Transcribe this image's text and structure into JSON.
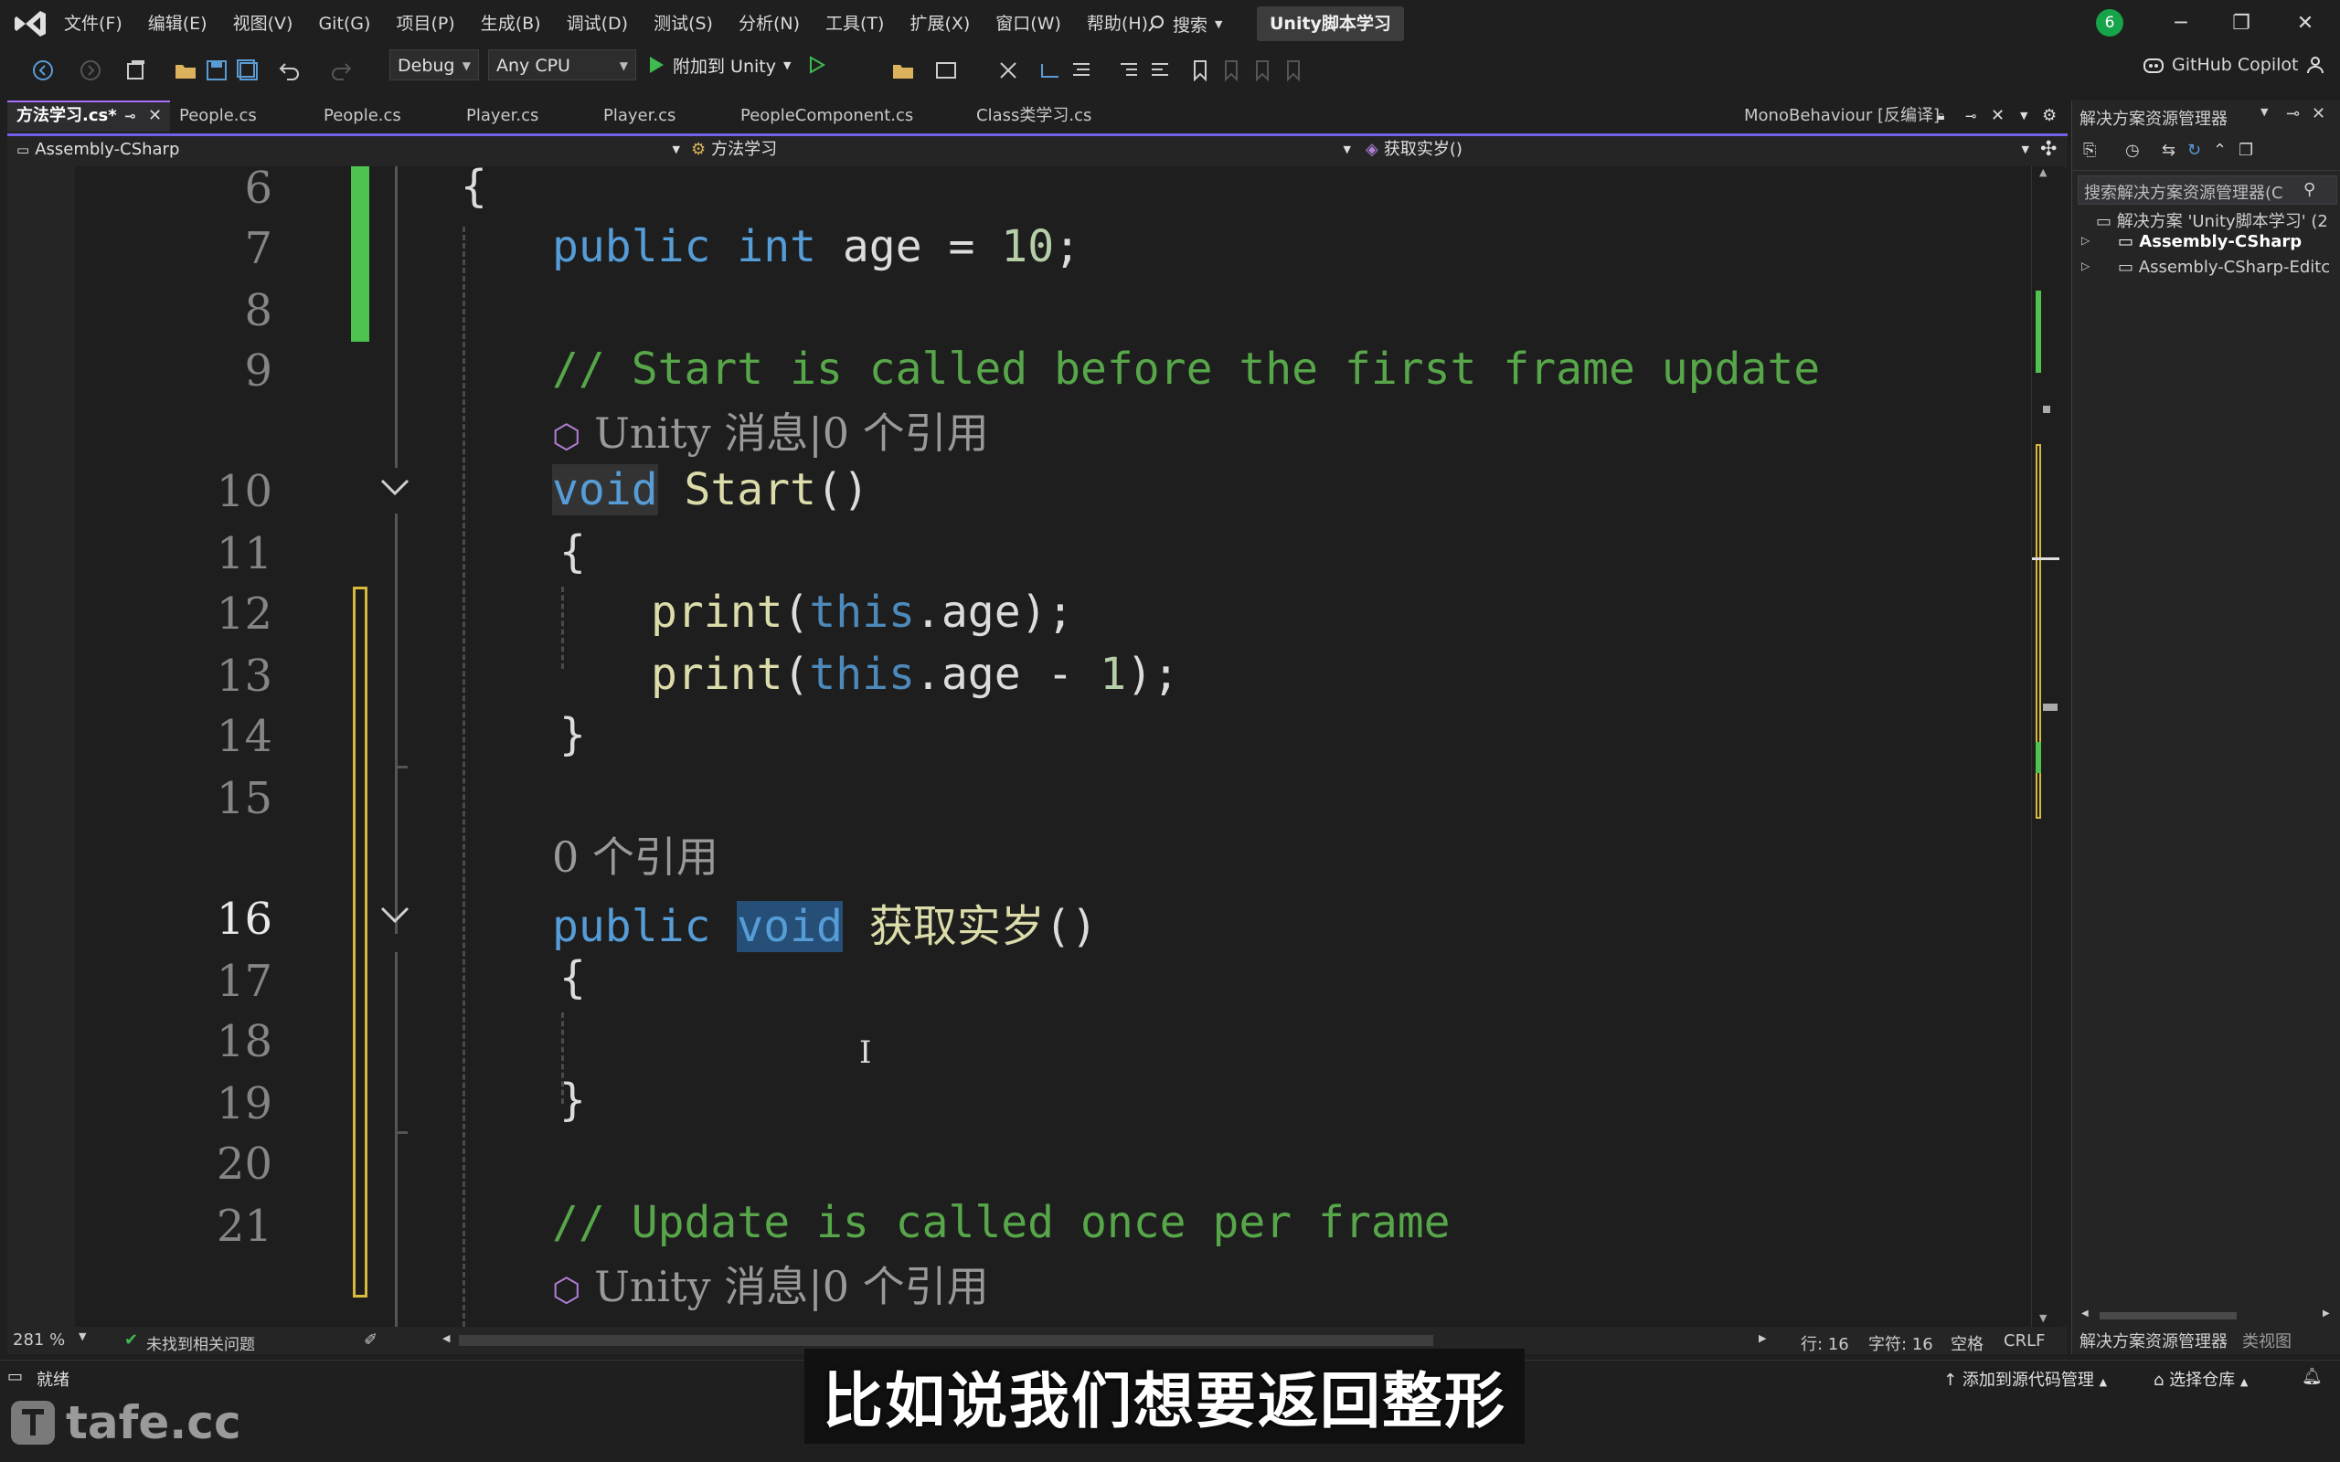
{
  "title_bar": {
    "menu": [
      "文件(F)",
      "编辑(E)",
      "视图(V)",
      "Git(G)",
      "项目(P)",
      "生成(B)",
      "调试(D)",
      "测试(S)",
      "分析(N)",
      "工具(T)",
      "扩展(X)",
      "窗口(W)",
      "帮助(H)"
    ],
    "search_label": "搜索",
    "project_name": "Unity脚本学习",
    "notification_count": "6"
  },
  "toolbar": {
    "config": "Debug",
    "platform": "Any CPU",
    "attach_label": "附加到 Unity",
    "copilot_label": "GitHub Copilot"
  },
  "tabs": [
    {
      "label": "方法学习.cs*",
      "active": true
    },
    {
      "label": "People.cs"
    },
    {
      "label": "People.cs"
    },
    {
      "label": "Player.cs"
    },
    {
      "label": "Player.cs"
    },
    {
      "label": "PeopleComponent.cs"
    },
    {
      "label": "Class类学习.cs"
    }
  ],
  "right_tab": "MonoBehaviour [反编译]",
  "navbar": {
    "project": "Assembly-CSharp",
    "class": "方法学习",
    "member": "获取实岁()"
  },
  "editor": {
    "line_numbers": [
      "6",
      "7",
      "8",
      "9",
      "10",
      "11",
      "12",
      "13",
      "14",
      "15",
      "16",
      "17",
      "18",
      "19",
      "20",
      "21"
    ],
    "current_line": "16",
    "code": {
      "brace_open": "{",
      "l7_kw1": "public",
      "l7_kw2": "int",
      "l7_rest": "age = ",
      "l7_num": "10",
      "l7_end": ";",
      "l9_comment": "// Start is called before the first frame update",
      "lens_start": "Unity 消息|0 个引用",
      "l10_void": "void",
      "l10_name": "Start",
      "l10_paren": "()",
      "l12_print": "print",
      "l12_open": "(",
      "l12_this": "this",
      "l12_rest": ".age);",
      "l13_print": "print",
      "l13_open": "(",
      "l13_this": "this",
      "l13_mid": ".age - ",
      "l13_num": "1",
      "l13_end": ");",
      "brace_close": "}",
      "lens_refs": "0 个引用",
      "l16_public": "public",
      "l16_void": "void",
      "l16_name": "获取实岁",
      "l16_paren": "()",
      "l21_comment": "// Update is called once per frame",
      "lens_update": "Unity 消息|0 个引用"
    }
  },
  "editor_status": {
    "zoom": "281 %",
    "issues": "未找到相关问题",
    "line": "行: 16",
    "col": "字符: 16",
    "whitespace": "空格",
    "eol": "CRLF"
  },
  "solution_explorer": {
    "title": "解决方案资源管理器",
    "search_placeholder": "搜索解决方案资源管理器(C",
    "solution": "解决方案 'Unity脚本学习' (2",
    "projects": [
      "Assembly-CSharp",
      "Assembly-CSharp-Editc"
    ],
    "bottom_tabs": [
      "解决方案资源管理器",
      "类视图"
    ]
  },
  "status_bar": {
    "ready": "就绪",
    "add_source": "添加到源代码管理",
    "select_repo": "选择仓库"
  },
  "subtitle": "比如说我们想要返回整形",
  "watermark": "tafe.cc",
  "colors": {
    "accent": "#7160e8",
    "keyword": "#569cd6",
    "comment": "#57a64a",
    "method": "#dcdcaa",
    "number": "#b5cea8",
    "change_saved": "#4ec34e",
    "change_unsaved": "#d7ba3a"
  }
}
